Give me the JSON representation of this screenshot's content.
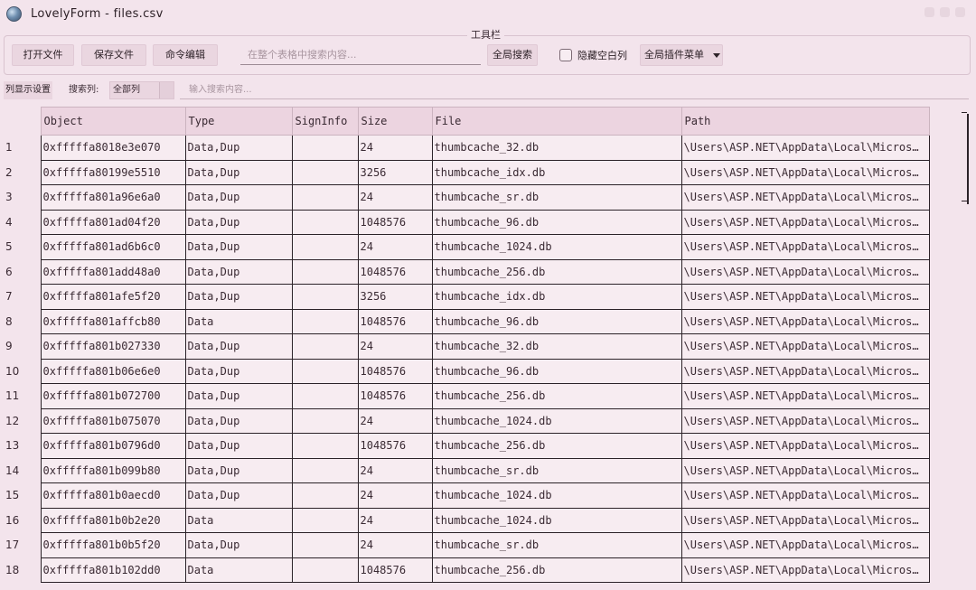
{
  "window": {
    "title": "LovelyForm - files.csv"
  },
  "toolbar": {
    "caption": "工具栏",
    "open_label": "打开文件",
    "save_label": "保存文件",
    "cmd_label": "命令编辑",
    "global_search_placeholder": "在整个表格中搜索内容...",
    "global_search_button": "全局搜索",
    "hide_empty_label": "隐藏空白列",
    "hide_empty_checked": false,
    "plugin_menu_label": "全局插件菜单"
  },
  "column_bar": {
    "settings_label": "列显示设置",
    "search_col_label": "搜索列:",
    "search_col_value": "全部列",
    "search_placeholder": "输入搜索内容..."
  },
  "table": {
    "columns": [
      "Object",
      "Type",
      "SignInfo",
      "Size",
      "File",
      "Path"
    ],
    "rows": [
      {
        "n": "1",
        "object": "0xfffffa8018e3e070",
        "type": "Data,Dup",
        "sign": "",
        "size": "24",
        "file": "thumbcache_32.db",
        "path": "\\Users\\ASP.NET\\AppData\\Local\\Micros…"
      },
      {
        "n": "2",
        "object": "0xfffffa80199e5510",
        "type": "Data,Dup",
        "sign": "",
        "size": "3256",
        "file": "thumbcache_idx.db",
        "path": "\\Users\\ASP.NET\\AppData\\Local\\Micros…"
      },
      {
        "n": "3",
        "object": "0xfffffa801a96e6a0",
        "type": "Data,Dup",
        "sign": "",
        "size": "24",
        "file": "thumbcache_sr.db",
        "path": "\\Users\\ASP.NET\\AppData\\Local\\Micros…"
      },
      {
        "n": "4",
        "object": "0xfffffa801ad04f20",
        "type": "Data,Dup",
        "sign": "",
        "size": "1048576",
        "file": "thumbcache_96.db",
        "path": "\\Users\\ASP.NET\\AppData\\Local\\Micros…"
      },
      {
        "n": "5",
        "object": "0xfffffa801ad6b6c0",
        "type": "Data,Dup",
        "sign": "",
        "size": "24",
        "file": "thumbcache_1024.db",
        "path": "\\Users\\ASP.NET\\AppData\\Local\\Micros…"
      },
      {
        "n": "6",
        "object": "0xfffffa801add48a0",
        "type": "Data,Dup",
        "sign": "",
        "size": "1048576",
        "file": "thumbcache_256.db",
        "path": "\\Users\\ASP.NET\\AppData\\Local\\Micros…"
      },
      {
        "n": "7",
        "object": "0xfffffa801afe5f20",
        "type": "Data,Dup",
        "sign": "",
        "size": "3256",
        "file": "thumbcache_idx.db",
        "path": "\\Users\\ASP.NET\\AppData\\Local\\Micros…"
      },
      {
        "n": "8",
        "object": "0xfffffa801affcb80",
        "type": "Data",
        "sign": "",
        "size": "1048576",
        "file": "thumbcache_96.db",
        "path": "\\Users\\ASP.NET\\AppData\\Local\\Micros…"
      },
      {
        "n": "9",
        "object": "0xfffffa801b027330",
        "type": "Data,Dup",
        "sign": "",
        "size": "24",
        "file": "thumbcache_32.db",
        "path": "\\Users\\ASP.NET\\AppData\\Local\\Micros…"
      },
      {
        "n": "10",
        "object": "0xfffffa801b06e6e0",
        "type": "Data,Dup",
        "sign": "",
        "size": "1048576",
        "file": "thumbcache_96.db",
        "path": "\\Users\\ASP.NET\\AppData\\Local\\Micros…"
      },
      {
        "n": "11",
        "object": "0xfffffa801b072700",
        "type": "Data,Dup",
        "sign": "",
        "size": "1048576",
        "file": "thumbcache_256.db",
        "path": "\\Users\\ASP.NET\\AppData\\Local\\Micros…"
      },
      {
        "n": "12",
        "object": "0xfffffa801b075070",
        "type": "Data,Dup",
        "sign": "",
        "size": "24",
        "file": "thumbcache_1024.db",
        "path": "\\Users\\ASP.NET\\AppData\\Local\\Micros…"
      },
      {
        "n": "13",
        "object": "0xfffffa801b0796d0",
        "type": "Data,Dup",
        "sign": "",
        "size": "1048576",
        "file": "thumbcache_256.db",
        "path": "\\Users\\ASP.NET\\AppData\\Local\\Micros…"
      },
      {
        "n": "14",
        "object": "0xfffffa801b099b80",
        "type": "Data,Dup",
        "sign": "",
        "size": "24",
        "file": "thumbcache_sr.db",
        "path": "\\Users\\ASP.NET\\AppData\\Local\\Micros…"
      },
      {
        "n": "15",
        "object": "0xfffffa801b0aecd0",
        "type": "Data,Dup",
        "sign": "",
        "size": "24",
        "file": "thumbcache_1024.db",
        "path": "\\Users\\ASP.NET\\AppData\\Local\\Micros…"
      },
      {
        "n": "16",
        "object": "0xfffffa801b0b2e20",
        "type": "Data",
        "sign": "",
        "size": "24",
        "file": "thumbcache_1024.db",
        "path": "\\Users\\ASP.NET\\AppData\\Local\\Micros…"
      },
      {
        "n": "17",
        "object": "0xfffffa801b0b5f20",
        "type": "Data,Dup",
        "sign": "",
        "size": "24",
        "file": "thumbcache_sr.db",
        "path": "\\Users\\ASP.NET\\AppData\\Local\\Micros…"
      },
      {
        "n": "18",
        "object": "0xfffffa801b102dd0",
        "type": "Data",
        "sign": "",
        "size": "1048576",
        "file": "thumbcache_256.db",
        "path": "\\Users\\ASP.NET\\AppData\\Local\\Micros…"
      }
    ]
  }
}
